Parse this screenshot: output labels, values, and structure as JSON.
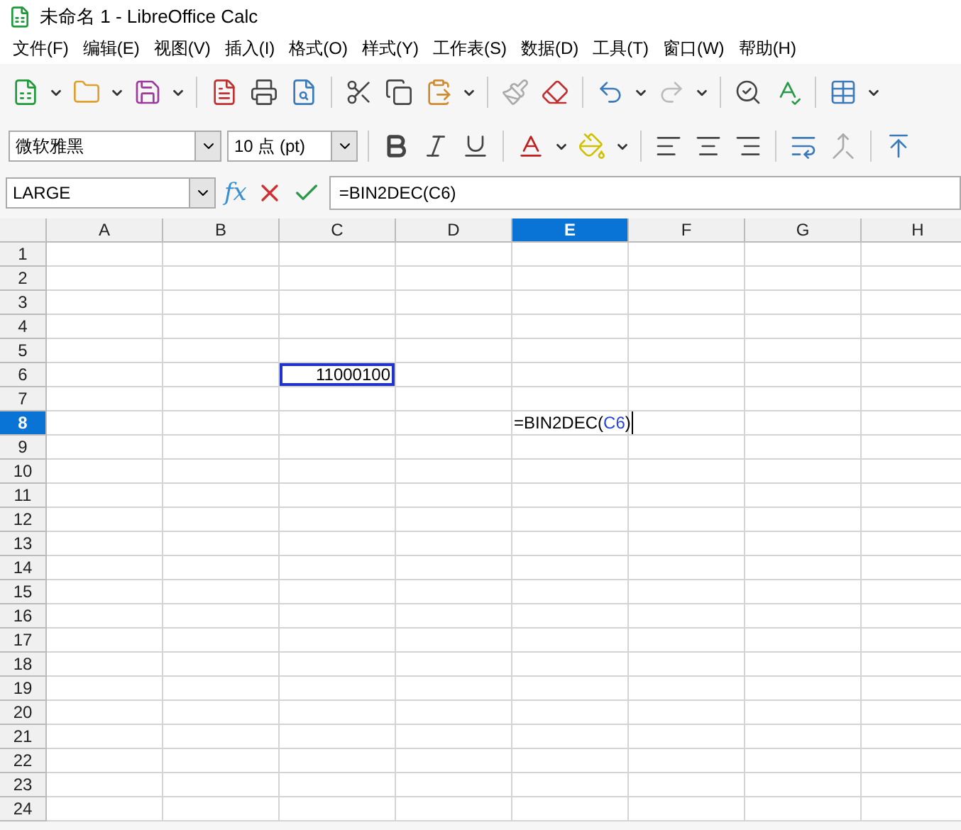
{
  "window": {
    "title": "未命名 1 - LibreOffice Calc"
  },
  "menu": [
    "文件(F)",
    "编辑(E)",
    "视图(V)",
    "插入(I)",
    "格式(O)",
    "样式(Y)",
    "工作表(S)",
    "数据(D)",
    "工具(T)",
    "窗口(W)",
    "帮助(H)"
  ],
  "format_bar": {
    "font_name": "微软雅黑",
    "font_size": "10 点 (pt)"
  },
  "formula_bar": {
    "name_box": "LARGE",
    "function_label": "fx",
    "formula": "=BIN2DEC(C6)"
  },
  "columns": [
    {
      "label": "A",
      "selected": false
    },
    {
      "label": "B",
      "selected": false
    },
    {
      "label": "C",
      "selected": false
    },
    {
      "label": "D",
      "selected": false
    },
    {
      "label": "E",
      "selected": true
    },
    {
      "label": "F",
      "selected": false
    },
    {
      "label": "G",
      "selected": false
    },
    {
      "label": "H",
      "selected": false
    }
  ],
  "rows": [
    {
      "label": "1",
      "selected": false
    },
    {
      "label": "2",
      "selected": false
    },
    {
      "label": "3",
      "selected": false
    },
    {
      "label": "4",
      "selected": false
    },
    {
      "label": "5",
      "selected": false
    },
    {
      "label": "6",
      "selected": false,
      "cells": [
        null,
        null,
        {
          "value": [
            {
              "text": "11000100",
              "kind": "number"
            }
          ],
          "referenced": true
        },
        null,
        null,
        null,
        null,
        null
      ]
    },
    {
      "label": "7",
      "selected": false
    },
    {
      "label": "8",
      "selected": true,
      "cells": [
        null,
        null,
        null,
        null,
        {
          "value": [
            {
              "text": "=BIN2DEC(",
              "kind": "plain"
            },
            {
              "text": "C6",
              "kind": "ref"
            },
            {
              "text": ")",
              "kind": "plain"
            }
          ],
          "editing": true
        },
        null,
        null,
        null
      ]
    },
    {
      "label": "9",
      "selected": false
    },
    {
      "label": "10",
      "selected": false
    },
    {
      "label": "11",
      "selected": false
    },
    {
      "label": "12",
      "selected": false
    },
    {
      "label": "13",
      "selected": false
    },
    {
      "label": "14",
      "selected": false
    },
    {
      "label": "15",
      "selected": false
    },
    {
      "label": "16",
      "selected": false
    },
    {
      "label": "17",
      "selected": false
    },
    {
      "label": "18",
      "selected": false
    },
    {
      "label": "19",
      "selected": false
    },
    {
      "label": "20",
      "selected": false
    },
    {
      "label": "21",
      "selected": false
    },
    {
      "label": "22",
      "selected": false
    },
    {
      "label": "23",
      "selected": false
    },
    {
      "label": "24",
      "selected": false
    }
  ]
}
